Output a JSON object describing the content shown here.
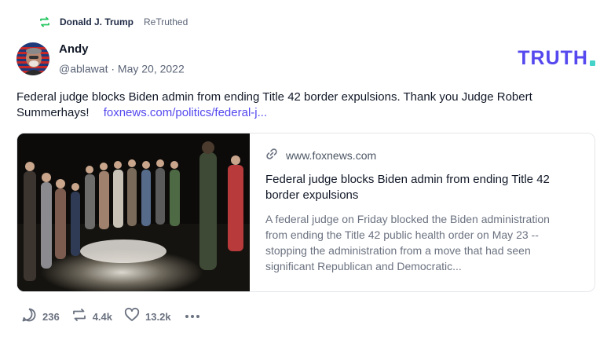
{
  "retruth": {
    "icon": "retruth-icon",
    "user_name": "Donald J. Trump",
    "tag": "ReTruthed"
  },
  "author": {
    "display_name": "Andy",
    "handle": "@ablawat",
    "separator": "·",
    "date": "May 20, 2022"
  },
  "brand": {
    "text": "TRUTH",
    "color": "#5448ee",
    "dot_color": "#45d3c9"
  },
  "post": {
    "text": "Federal judge blocks Biden admin from ending Title 42 border expulsions. Thank you Judge Robert Summerhays!",
    "link_text": "foxnews.com/politics/federal-j..."
  },
  "link_card": {
    "domain": "www.foxnews.com",
    "title": "Federal judge blocks Biden admin from ending Title 42 border expulsions",
    "description": "A federal judge on Friday blocked the Biden administration from ending the Title 42 public health order on May 23 -- stopping the administration from a move that had seen significant Republican and Democratic..."
  },
  "actions": {
    "replies": "236",
    "retruths": "4.4k",
    "likes": "13.2k"
  }
}
